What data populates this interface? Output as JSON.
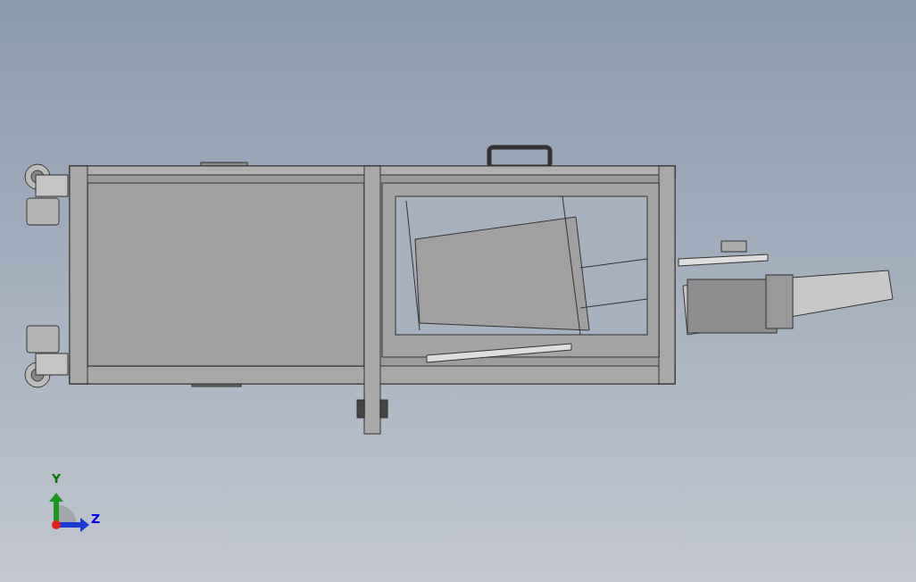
{
  "viewport": {
    "triad": {
      "axes": [
        {
          "label": "Y",
          "kind": "vertical",
          "color": "#007a00"
        },
        {
          "label": "Z",
          "kind": "horizontal",
          "color": "#0000ee"
        }
      ]
    }
  }
}
